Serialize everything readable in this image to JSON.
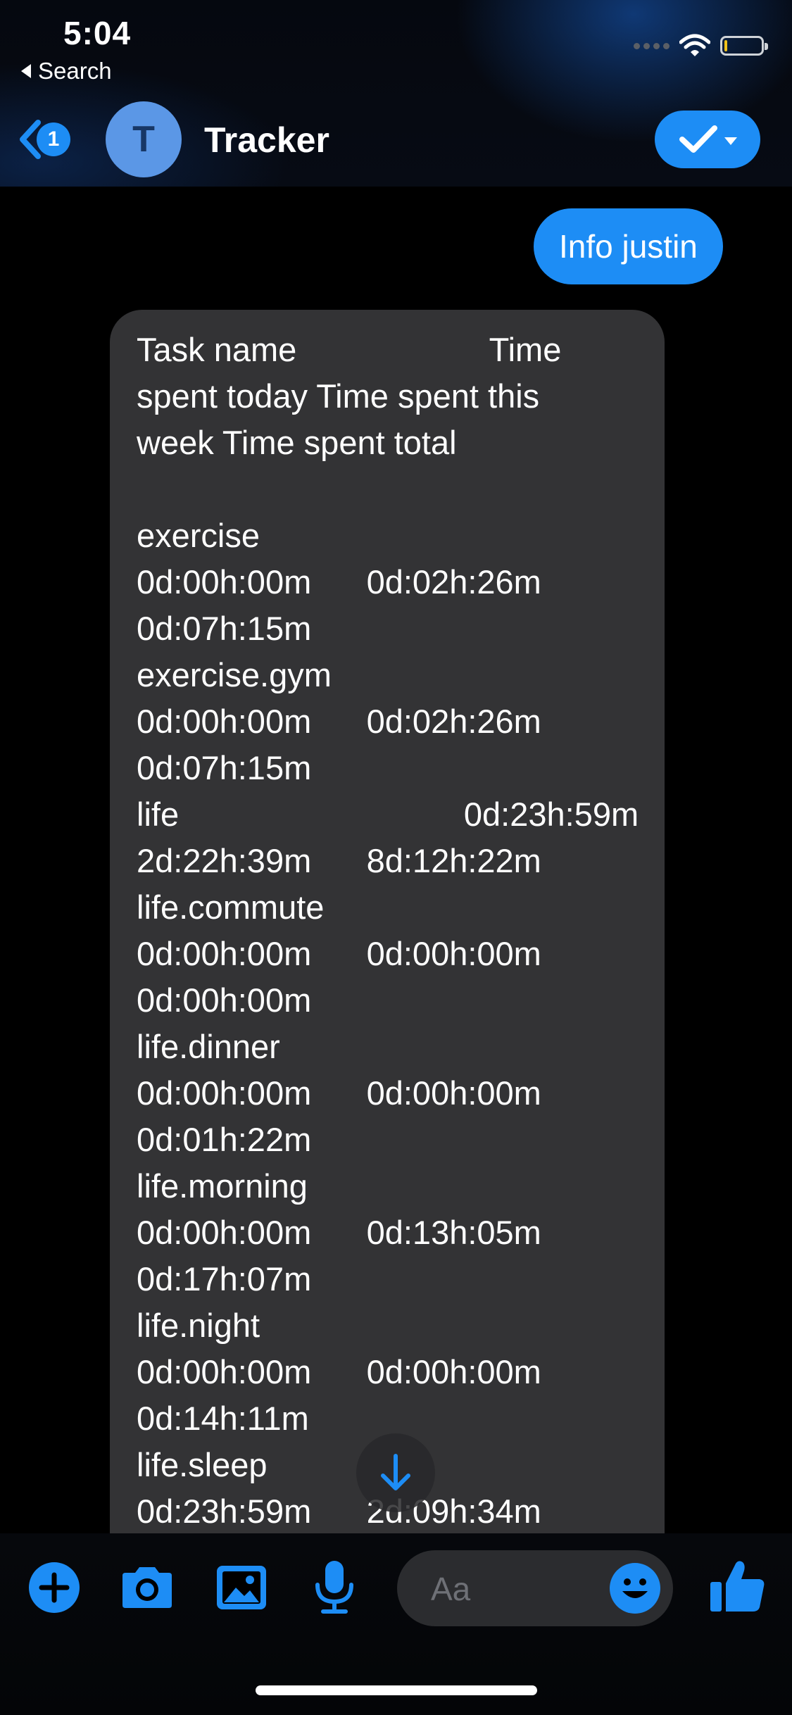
{
  "status_bar": {
    "time": "5:04",
    "back_app_label": "Search"
  },
  "header": {
    "unread_count": "1",
    "avatar_initial": "T",
    "title": "Tracker"
  },
  "messages": {
    "sent": "Info justin",
    "received": "Task name                     Time\nspent today Time spent this\nweek Time spent total\n\nexercise\n0d:00h:00m      0d:02h:26m\n0d:07h:15m\nexercise.gym\n0d:00h:00m      0d:02h:26m\n0d:07h:15m\nlife                               0d:23h:59m\n2d:22h:39m      8d:12h:22m\nlife.commute\n0d:00h:00m      0d:00h:00m\n0d:00h:00m\nlife.dinner\n0d:00h:00m      0d:00h:00m\n0d:01h:22m\nlife.morning\n0d:00h:00m      0d:13h:05m\n0d:17h:07m\nlife.night\n0d:00h:00m      0d:00h:00m\n0d:14h:11m\nlife.sleep\n0d:23h:59m      2d:09h:34m"
  },
  "composer": {
    "placeholder": "Aa",
    "icons": [
      "plus-icon",
      "camera-icon",
      "image-icon",
      "microphone-icon",
      "emoji-icon",
      "thumbs-up-icon"
    ]
  },
  "colors": {
    "accent": "#1d8df5",
    "bubble_received": "#333335",
    "background": "#000000"
  }
}
